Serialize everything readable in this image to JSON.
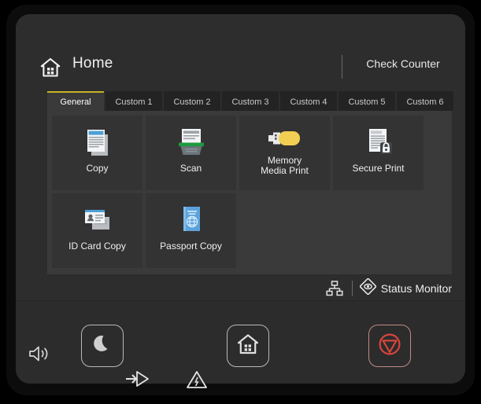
{
  "header": {
    "title": "Home",
    "home_icon": "home-house-icon",
    "check_counter": "Check Counter"
  },
  "tabs": [
    {
      "label": "General",
      "active": true
    },
    {
      "label": "Custom 1",
      "active": false
    },
    {
      "label": "Custom 2",
      "active": false
    },
    {
      "label": "Custom 3",
      "active": false
    },
    {
      "label": "Custom 4",
      "active": false
    },
    {
      "label": "Custom 5",
      "active": false
    },
    {
      "label": "Custom 6",
      "active": false
    }
  ],
  "tiles": [
    {
      "label": "Copy",
      "icon": "copy-document-icon"
    },
    {
      "label": "Scan",
      "icon": "scanner-icon"
    },
    {
      "label": "Memory\nMedia Print",
      "line1": "Memory",
      "line2": "Media Print",
      "icon": "usb-flash-drive-icon"
    },
    {
      "label": "Secure Print",
      "icon": "document-lock-icon"
    },
    {
      "label": "ID Card Copy",
      "icon": "id-card-icon"
    },
    {
      "label": "Passport Copy",
      "icon": "passport-booklet-icon"
    }
  ],
  "status_bar": {
    "network_icon": "network-lan-icon",
    "status_monitor_icon": "status-monitor-eye-icon",
    "status_monitor_label": "Status Monitor"
  },
  "hardware": {
    "speaker_icon": "speaker-volume-icon",
    "sleep_icon": "moon-sleep-icon",
    "home_icon": "home-house-icon",
    "stop_icon": "stop-circle-triangle-icon",
    "data_indicator_icon": "data-arrow-indicator-icon",
    "error_indicator_icon": "warning-triangle-icon"
  },
  "colors": {
    "accent_tab": "#c9b425",
    "screen_bg": "#2d2d2d",
    "tile_panel_bg": "#3a3a3a",
    "tile_bg": "#333333",
    "stop_red": "#d9453c",
    "scan_green": "#1d9a3f",
    "usb_yellow": "#f2cf52",
    "doc_blue": "#4d9fd6",
    "passport_blue": "#5ba3dd"
  }
}
